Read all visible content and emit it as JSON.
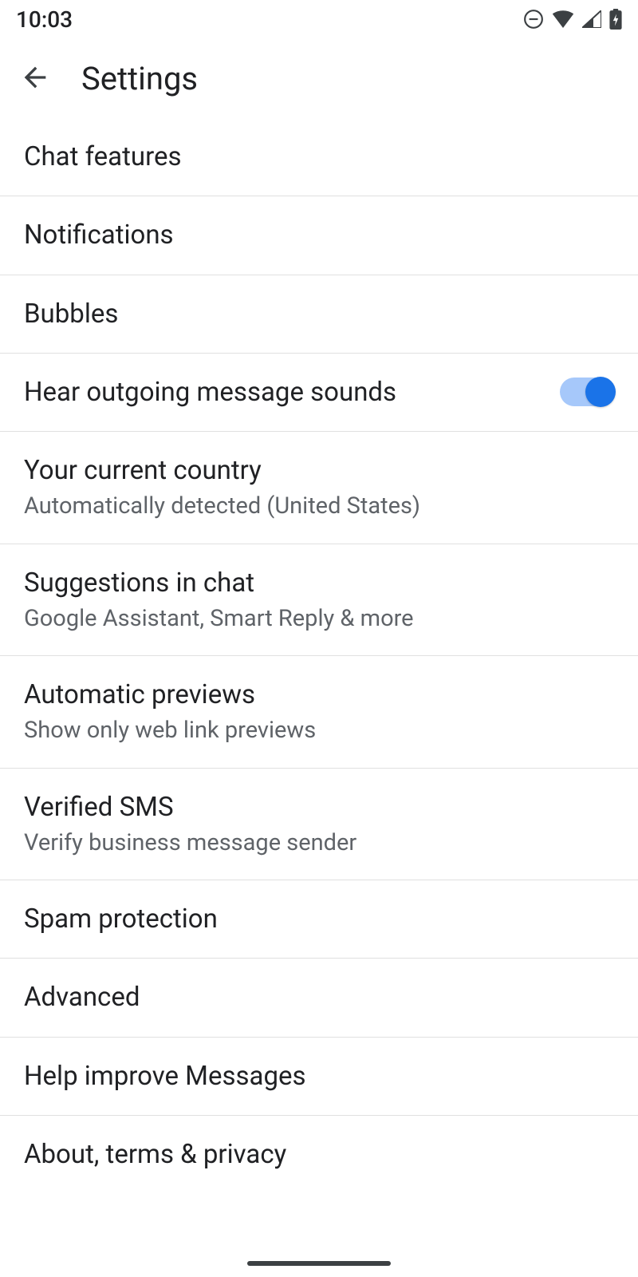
{
  "status": {
    "time": "10:03"
  },
  "header": {
    "title": "Settings"
  },
  "rows": {
    "chat_features": {
      "title": "Chat features"
    },
    "notifications": {
      "title": "Notifications"
    },
    "bubbles": {
      "title": "Bubbles"
    },
    "hear_sounds": {
      "title": "Hear outgoing message sounds",
      "toggle": true
    },
    "country": {
      "title": "Your current country",
      "subtitle": "Automatically detected (United States)"
    },
    "suggestions": {
      "title": "Suggestions in chat",
      "subtitle": "Google Assistant, Smart Reply & more"
    },
    "auto_previews": {
      "title": "Automatic previews",
      "subtitle": "Show only web link previews"
    },
    "verified_sms": {
      "title": "Verified SMS",
      "subtitle": "Verify business message sender"
    },
    "spam": {
      "title": "Spam protection"
    },
    "advanced": {
      "title": "Advanced"
    },
    "help_improve": {
      "title": "Help improve Messages"
    },
    "about": {
      "title": "About, terms & privacy"
    }
  }
}
